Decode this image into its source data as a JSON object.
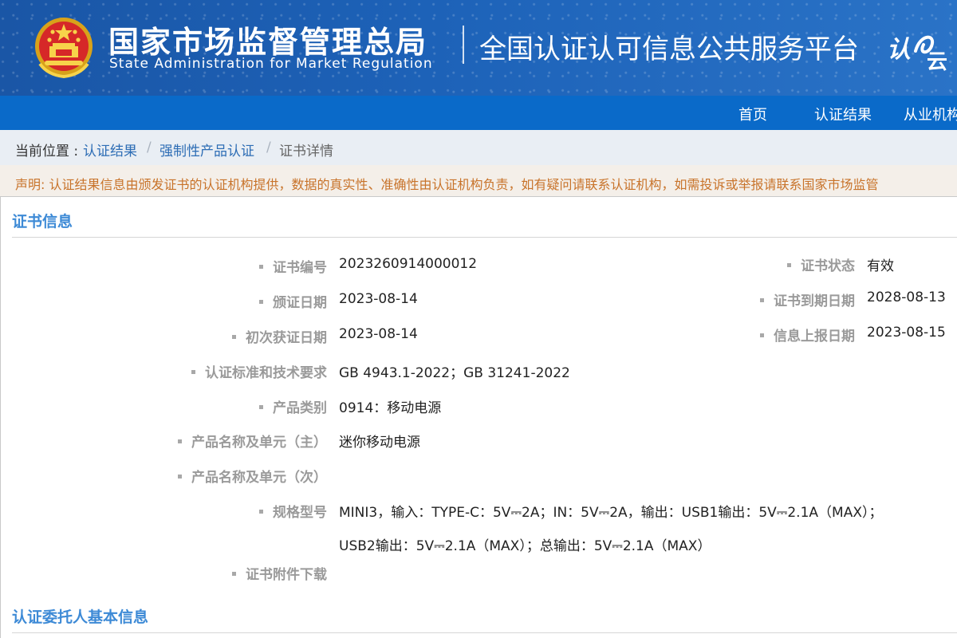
{
  "header": {
    "org_name_cn": "国家市场监督管理总局",
    "org_name_en": "State Administration  for  Market Regulation",
    "platform_title": "全国认证认可信息公共服务平台",
    "logo_text": "认云",
    "emblem_icon": "national-emblem-icon",
    "colors": {
      "header_bg": "#1d62b8",
      "nav_bg": "#0a6ac9"
    }
  },
  "nav": {
    "items": [
      {
        "label": "首页"
      },
      {
        "label": "认证结果"
      },
      {
        "label": "从业机构"
      }
    ]
  },
  "breadcrumb": {
    "prefix": "当前位置 :",
    "items": [
      "认证结果",
      "强制性产品认证",
      "证书详情"
    ],
    "separator": "/"
  },
  "notice": {
    "text": "声明: 认证结果信息由颁发证书的认证机构提供，数据的真实性、准确性由认证机构负责，如有疑问请联系认证机构，如需投诉或举报请联系国家市场监管"
  },
  "certificate": {
    "section_title": "证书信息",
    "fields": {
      "cert_no": {
        "label": "证书编号",
        "value": "2023260914000012"
      },
      "issue_date": {
        "label": "颁证日期",
        "value": "2023-08-14"
      },
      "first_date": {
        "label": "初次获证日期",
        "value": "2023-08-14"
      },
      "standards": {
        "label": "认证标准和技术要求",
        "value": "GB 4943.1-2022；GB 31241-2022"
      },
      "category": {
        "label": "产品类别",
        "value": "0914：移动电源"
      },
      "product_main": {
        "label": "产品名称及单元（主）",
        "value": "迷你移动电源"
      },
      "product_sub": {
        "label": "产品名称及单元（次）",
        "value": ""
      },
      "model": {
        "label": "规格型号",
        "value_line1": "MINI3，输入：TYPE-C：5V⎓2A；IN：5V⎓2A，输出：USB1输出：5V⎓2.1A（MAX）；",
        "value_line2": "USB2输出：5V⎓2.1A（MAX）；总输出：5V⎓2.1A（MAX）"
      },
      "attachment": {
        "label": "证书附件下载",
        "value": ""
      },
      "status": {
        "label": "证书状态",
        "value": "有效"
      },
      "expiry_date": {
        "label": "证书到期日期",
        "value": "2028-08-13"
      },
      "report_date": {
        "label": "信息上报日期",
        "value": "2023-08-15"
      }
    }
  },
  "entrust": {
    "section_title": "认证委托人基本信息"
  }
}
